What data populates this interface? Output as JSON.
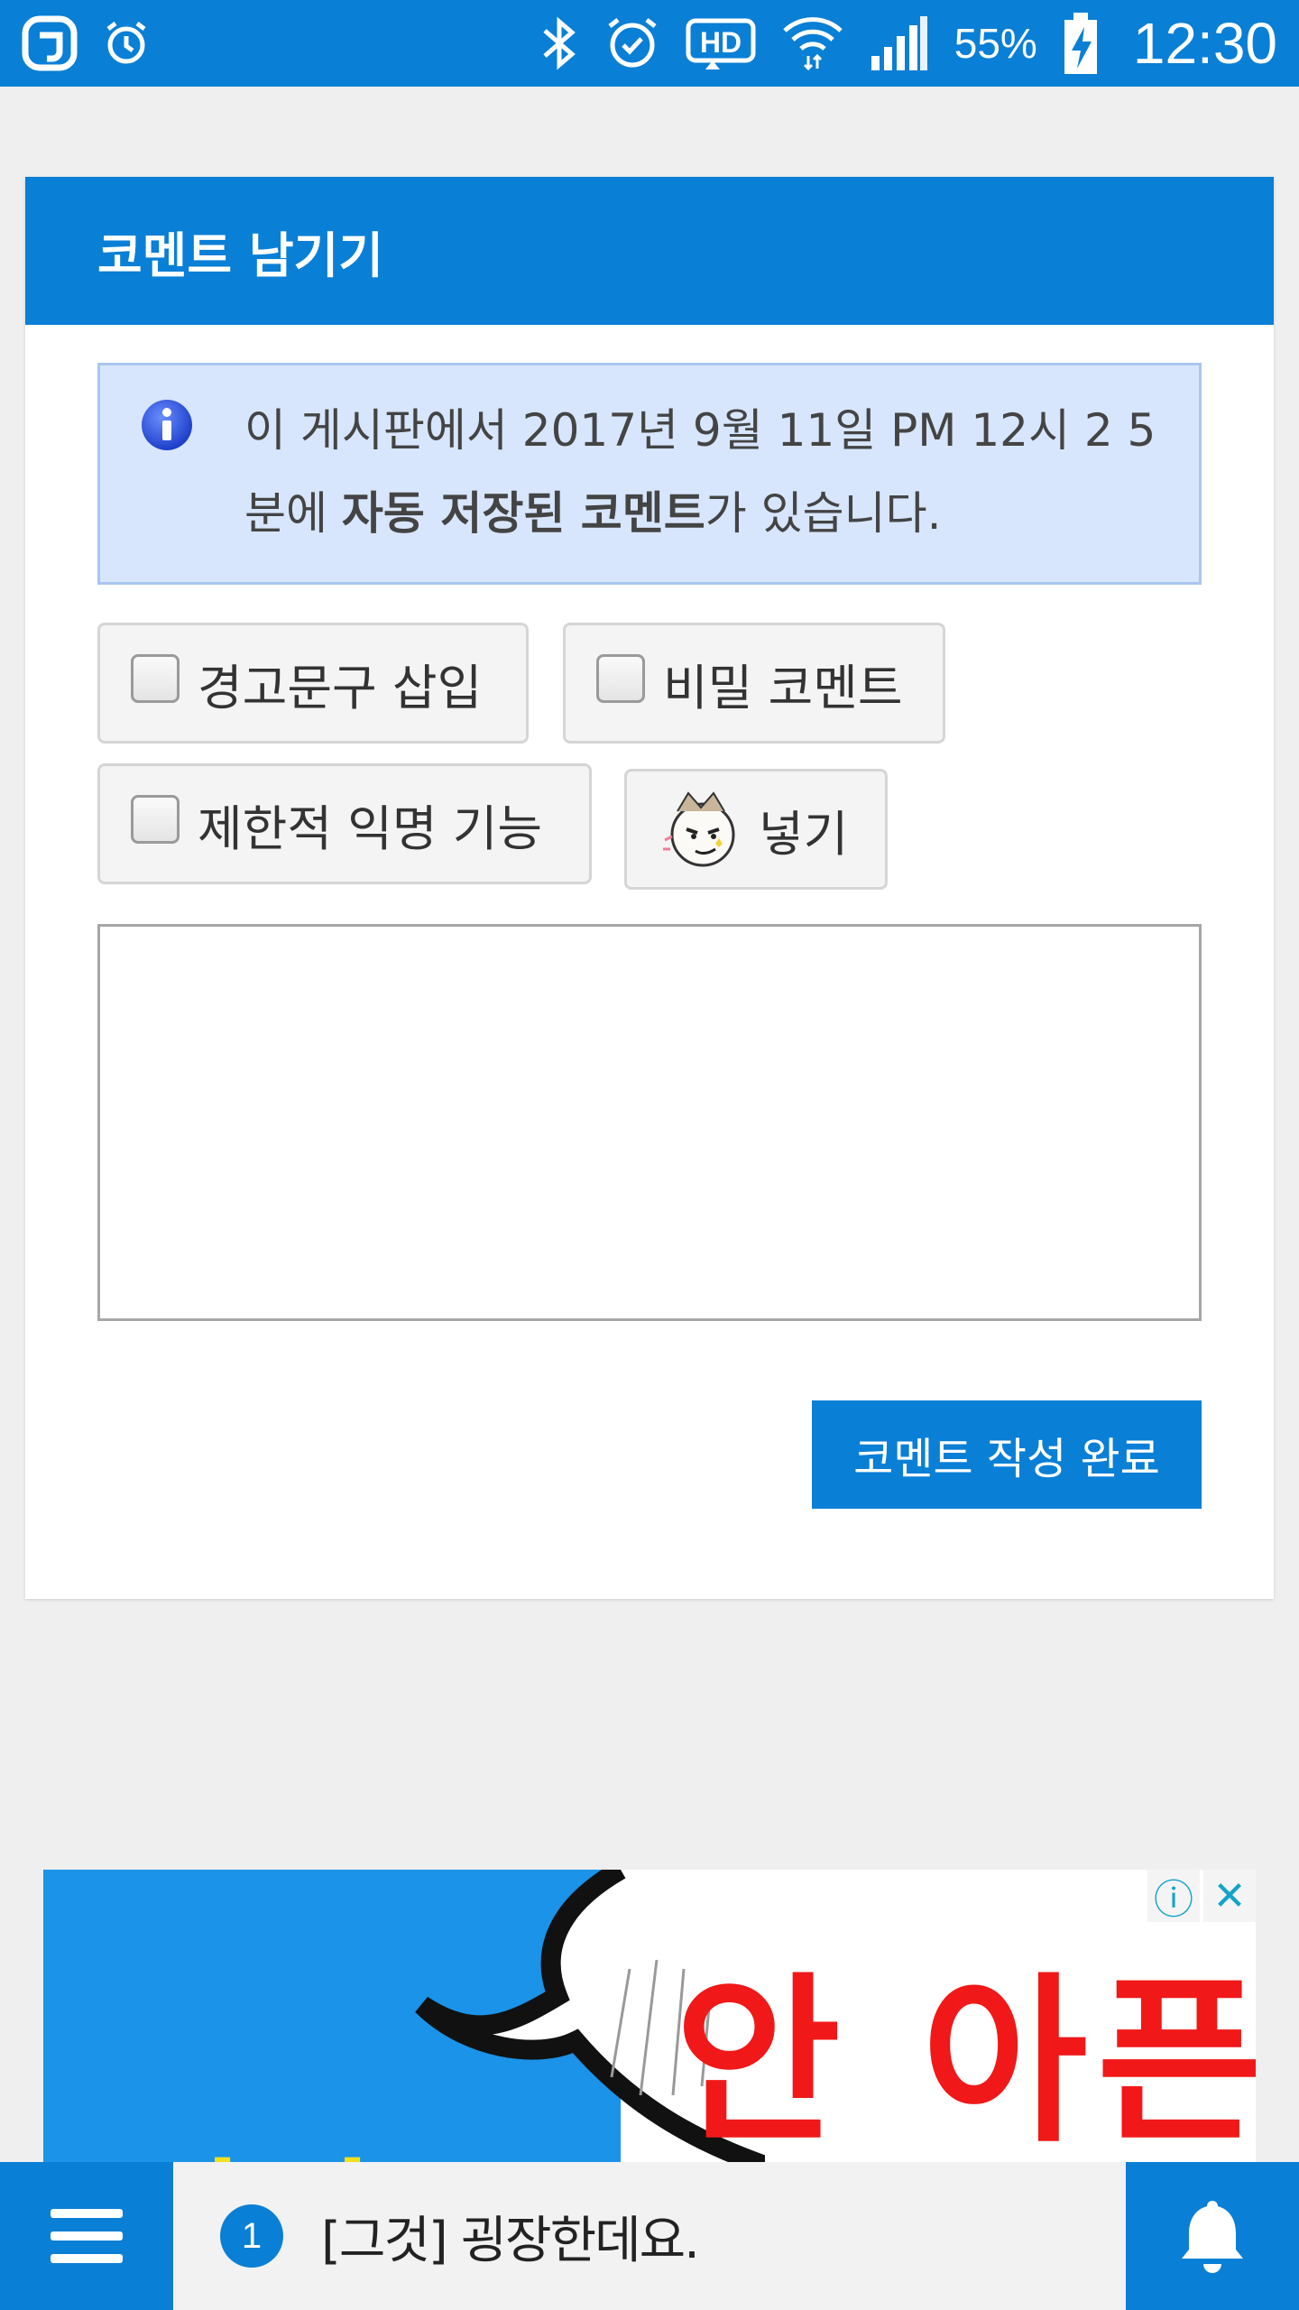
{
  "status_bar": {
    "battery_percent": "55%",
    "time": "12:30",
    "icons": [
      "app-logo-icon",
      "alarm-icon",
      "bluetooth-icon",
      "alarm-check-icon",
      "hd-icon",
      "wifi-icon",
      "signal-icon",
      "battery-charging-icon"
    ],
    "hd_label": "HD"
  },
  "comment_form": {
    "title": "코멘트 남기기",
    "notice": {
      "prefix": "이 게시판에서 2017년 9월 11일 PM 12시 2 5분에 ",
      "bold": "자동 저장된 코멘트",
      "suffix": "가 있습니다."
    },
    "options": {
      "warning_label": "경고문구 삽입",
      "secret_label": "비밀 코멘트",
      "anonymous_label": "제한적 익명 기능",
      "insert_emoticon_label": "넣기"
    },
    "textarea_value": "",
    "submit_label": "코멘트 작성 완료"
  },
  "ad": {
    "headline": "안 아픈",
    "sub_text": "발기",
    "info_icon": "ⓘ",
    "close_icon": "✕"
  },
  "bottom_bar": {
    "badge_count": "1",
    "message": "[그것] 굉장한데요."
  },
  "colors": {
    "primary": "#0a7fd6",
    "notice_bg": "#d8e6fd",
    "ad_red": "#f01818"
  }
}
